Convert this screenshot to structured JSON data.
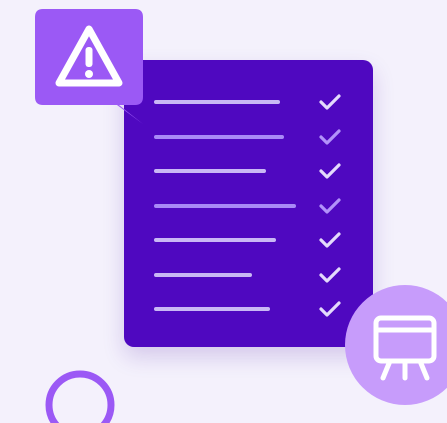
{
  "colors": {
    "background": "#F4F1FC",
    "card": "#4F08C0",
    "line_light": "#C9B8F5",
    "line_accent": "#A98AF7",
    "check_light": "#E4DAFC",
    "check_accent": "#B292FA",
    "bubble": "#9B59F5",
    "bubble_icon": "#FFFFFF",
    "presentation_circle": "#C79CFB",
    "presentation_icon": "#FFFFFF",
    "ring": "#9B59F5"
  },
  "checklist": {
    "rows": [
      {
        "line_fraction": 0.72,
        "accent": false
      },
      {
        "line_fraction": 0.74,
        "accent": true
      },
      {
        "line_fraction": 0.64,
        "accent": false
      },
      {
        "line_fraction": 0.81,
        "accent": true
      },
      {
        "line_fraction": 0.7,
        "accent": false
      },
      {
        "line_fraction": 0.56,
        "accent": false
      },
      {
        "line_fraction": 0.66,
        "accent": false
      }
    ]
  },
  "icons": {
    "warning": "warning-icon",
    "presentation": "presentation-board-icon",
    "check": "check-icon"
  }
}
